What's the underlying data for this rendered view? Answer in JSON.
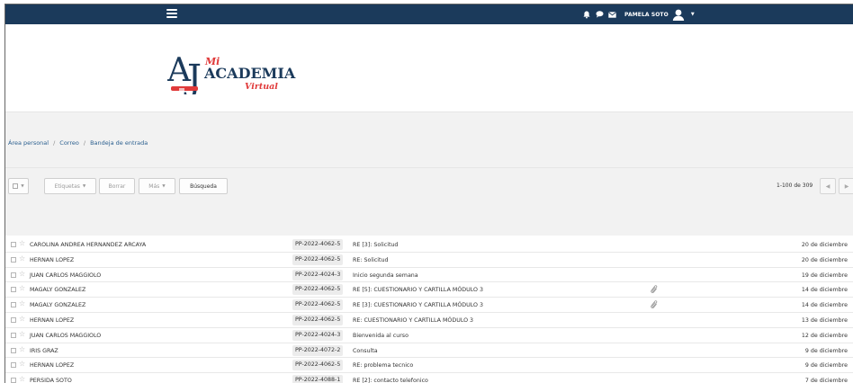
{
  "navbar": {
    "user_name": "PAMELA SOTO",
    "icons": [
      "bell-icon",
      "chat-icon",
      "envelope-icon",
      "avatar-icon",
      "caret-down-icon"
    ],
    "bg_color": "#1b3a5b"
  },
  "logo": {
    "mi": "Mi",
    "academia": "ACADEMIA",
    "virtual": "Virtual"
  },
  "breadcrumb": {
    "items": [
      "Área personal",
      "Correo",
      "Bandeja de entrada"
    ],
    "separator": "/"
  },
  "toolbar": {
    "labels_button": "Etiquetas",
    "delete_button": "Borrar",
    "more_button": "Más",
    "search_button": "Búsqueda",
    "pager_text": "1-100 de 309"
  },
  "messages": [
    {
      "sender": "CAROLINA ANDREA HERNANDEZ ARCAYA",
      "course": "PP-2022-4062-5",
      "subject": "RE [3]: Solicitud",
      "attachment": false,
      "date": "20 de diciembre"
    },
    {
      "sender": "HERNAN LOPEZ",
      "course": "PP-2022-4062-5",
      "subject": "RE: Solicitud",
      "attachment": false,
      "date": "20 de diciembre"
    },
    {
      "sender": "JUAN CARLOS MAGGIOLO",
      "course": "PP-2022-4024-3",
      "subject": "Inicio segunda semana",
      "attachment": false,
      "date": "19 de diciembre"
    },
    {
      "sender": "MAGALY GONZALEZ",
      "course": "PP-2022-4062-5",
      "subject": "RE [5]: CUESTIONARIO Y CARTILLA MÓDULO 3",
      "attachment": true,
      "date": "14 de diciembre"
    },
    {
      "sender": "MAGALY GONZALEZ",
      "course": "PP-2022-4062-5",
      "subject": "RE [3]: CUESTIONARIO Y CARTILLA MÓDULO 3",
      "attachment": true,
      "date": "14 de diciembre"
    },
    {
      "sender": "HERNAN LOPEZ",
      "course": "PP-2022-4062-5",
      "subject": "RE: CUESTIONARIO Y CARTILLA MÓDULO 3",
      "attachment": false,
      "date": "13 de diciembre"
    },
    {
      "sender": "JUAN CARLOS MAGGIOLO",
      "course": "PP-2022-4024-3",
      "subject": "Bienvenida al curso",
      "attachment": false,
      "date": "12 de diciembre"
    },
    {
      "sender": "IRIS GRAZ",
      "course": "PP-2022-4072-2",
      "subject": "Consulta",
      "attachment": false,
      "date": "9 de diciembre"
    },
    {
      "sender": "HERNAN LOPEZ",
      "course": "PP-2022-4062-5",
      "subject": "RE: problema tecnico",
      "attachment": false,
      "date": "9 de diciembre"
    },
    {
      "sender": "PERSIDA SOTO",
      "course": "PP-2022-4088-1",
      "subject": "RE [2]: contacto telefonico",
      "attachment": false,
      "date": "7 de diciembre"
    }
  ]
}
